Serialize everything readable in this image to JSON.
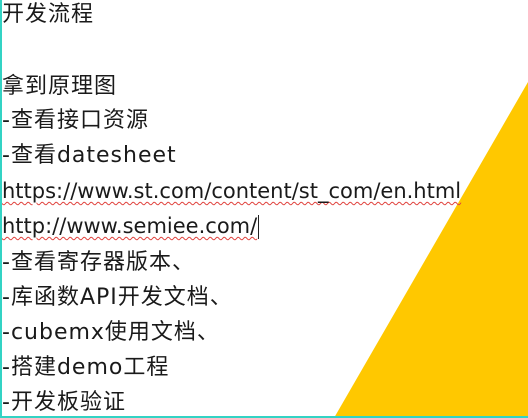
{
  "colors": {
    "accent_yellow": "#ffc800",
    "border_teal": "#33d3c4",
    "text": "#1a1a1a",
    "spellcheck": "#e0403b"
  },
  "title": "开发流程",
  "lines": [
    "拿到原理图",
    "-查看接口资源",
    "-查看datesheet",
    "https://www.st.com/content/st_com/en.html",
    "http://www.semiee.com/",
    "-查看寄存器版本、",
    "-库函数API开发文档、",
    "-cubemx使用文档、",
    "-搭建demo工程",
    "-开发板验证"
  ]
}
